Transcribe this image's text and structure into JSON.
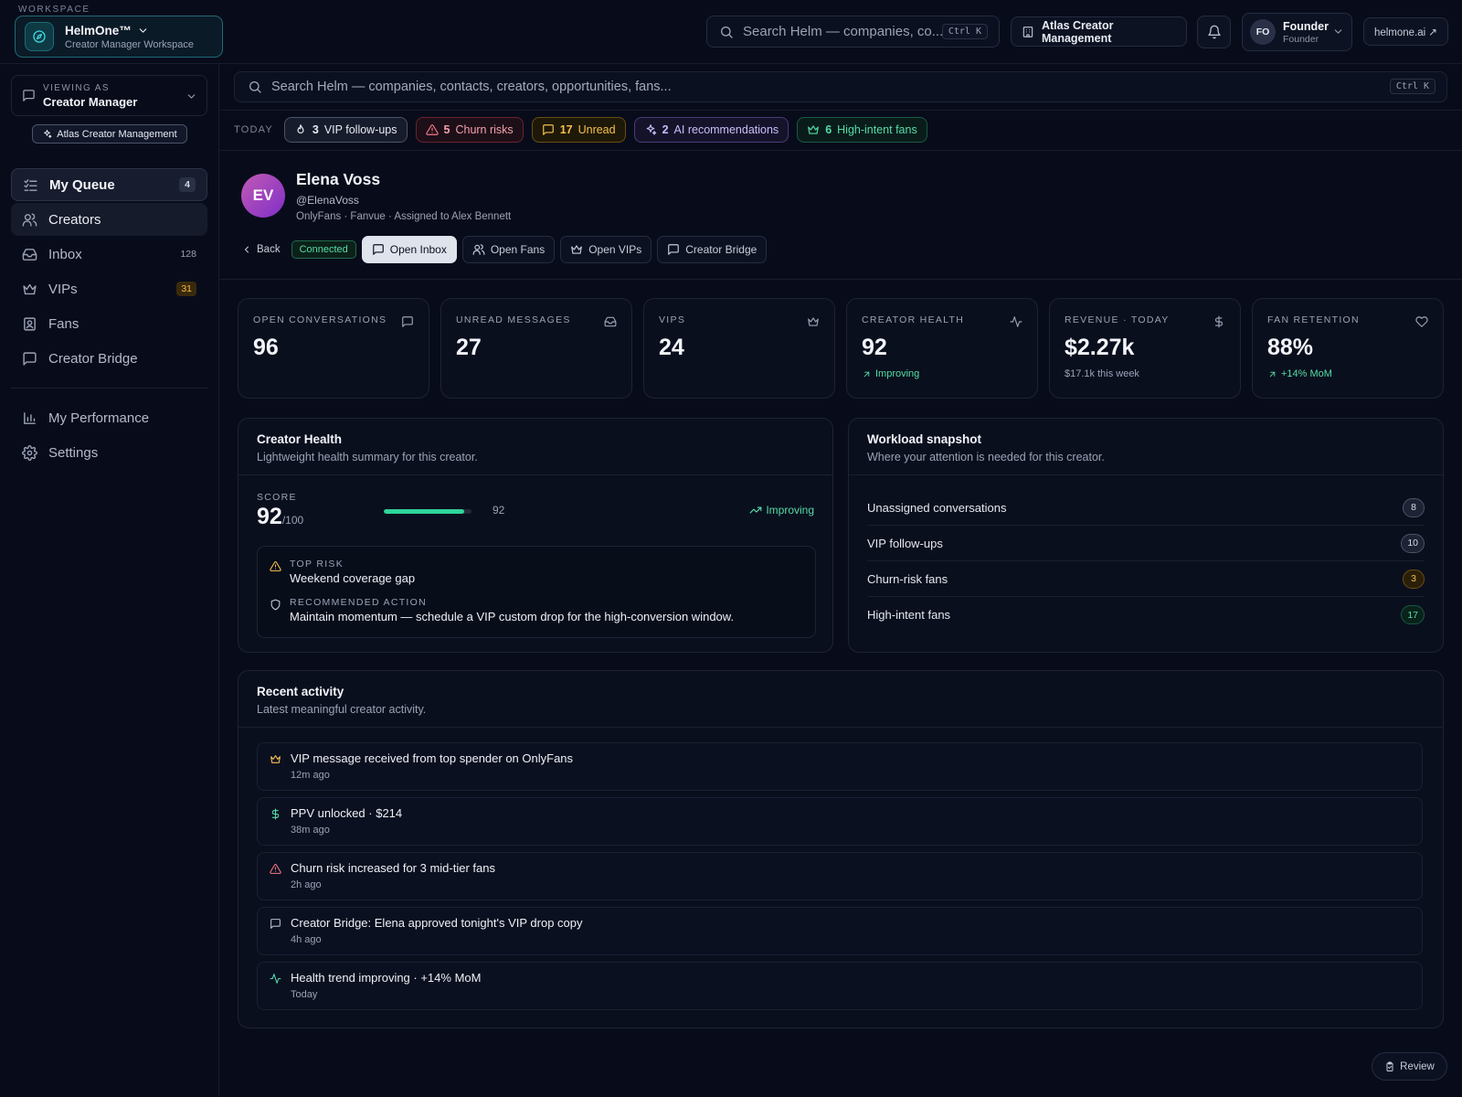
{
  "topbar": {
    "workspace_caption": "WORKSPACE",
    "workspace_name": "HelmOne™",
    "workspace_sub": "Creator Manager Workspace",
    "search_placeholder": "Search Helm — companies, co...",
    "search_shortcut": "Ctrl K",
    "org_name": "Atlas Creator Management",
    "user_initials": "FO",
    "user_name": "Founder",
    "user_role": "Founder",
    "site_link": "helmone.ai ↗"
  },
  "sidebar": {
    "viewing_as_caption": "VIEWING AS",
    "viewing_as_value": "Creator Manager",
    "org_pill": "Atlas Creator Management",
    "items": [
      {
        "label": "My Queue",
        "badge": "4",
        "icon": "list-check-icon"
      },
      {
        "label": "Creators",
        "badge": "",
        "icon": "users-icon"
      },
      {
        "label": "Inbox",
        "badge": "128",
        "icon": "inbox-icon"
      },
      {
        "label": "VIPs",
        "badge": "31",
        "icon": "crown-icon"
      },
      {
        "label": "Fans",
        "badge": "",
        "icon": "contact-icon"
      },
      {
        "label": "Creator Bridge",
        "badge": "",
        "icon": "message-icon"
      }
    ],
    "secondary": [
      {
        "label": "My Performance",
        "icon": "bar-chart-icon"
      },
      {
        "label": "Settings",
        "icon": "gear-icon"
      }
    ]
  },
  "main_search": {
    "placeholder": "Search Helm — companies, contacts, creators, opportunities, fans...",
    "shortcut": "Ctrl K"
  },
  "today": {
    "caption": "TODAY",
    "chips": [
      {
        "count": "3",
        "label": "VIP follow-ups",
        "tone": "neutral",
        "icon": "flame-icon"
      },
      {
        "count": "5",
        "label": "Churn risks",
        "tone": "red",
        "icon": "warning-icon"
      },
      {
        "count": "17",
        "label": "Unread",
        "tone": "amber",
        "icon": "message-icon"
      },
      {
        "count": "2",
        "label": "AI recommendations",
        "tone": "violet",
        "icon": "sparkles-icon"
      },
      {
        "count": "6",
        "label": "High-intent fans",
        "tone": "green",
        "icon": "crown-icon"
      }
    ]
  },
  "creator": {
    "initials": "EV",
    "name": "Elena Voss",
    "handle": "@ElenaVoss",
    "meta": "OnlyFans · Fanvue · Assigned to Alex Bennett",
    "back_label": "Back",
    "status": "Connected",
    "actions": [
      "Open Inbox",
      "Open Fans",
      "Open VIPs",
      "Creator Bridge"
    ]
  },
  "metrics": [
    {
      "caption": "OPEN CONVERSATIONS",
      "value": "96",
      "sub": "",
      "icon": "message-icon"
    },
    {
      "caption": "UNREAD MESSAGES",
      "value": "27",
      "sub": "",
      "icon": "inbox-icon"
    },
    {
      "caption": "VIPS",
      "value": "24",
      "sub": "",
      "icon": "crown-icon"
    },
    {
      "caption": "CREATOR HEALTH",
      "value": "92",
      "sub": "Improving",
      "icon": "activity-icon"
    },
    {
      "caption": "REVENUE · TODAY",
      "value": "$2.27k",
      "sub": "$17.1k this week",
      "icon": "dollar-icon"
    },
    {
      "caption": "FAN RETENTION",
      "value": "88%",
      "sub": "+14% MoM",
      "icon": "heart-icon"
    }
  ],
  "health": {
    "title": "Creator Health",
    "subtitle": "Lightweight health summary for this creator.",
    "score_caption": "SCORE",
    "score": "92",
    "score_max": "/100",
    "score_fraction": 0.92,
    "bar_label": "92",
    "trend": "Improving",
    "top_risk_caption": "TOP RISK",
    "top_risk": "Weekend coverage gap",
    "action_caption": "RECOMMENDED ACTION",
    "action": "Maintain momentum — schedule a VIP custom drop for the high-conversion window."
  },
  "workload": {
    "title": "Workload snapshot",
    "subtitle": "Where your attention is needed for this creator.",
    "rows": [
      {
        "label": "Unassigned conversations",
        "count": "8",
        "tone": "gray"
      },
      {
        "label": "VIP follow-ups",
        "count": "10",
        "tone": "gray"
      },
      {
        "label": "Churn-risk fans",
        "count": "3",
        "tone": "amber"
      },
      {
        "label": "High-intent fans",
        "count": "17",
        "tone": "green"
      }
    ]
  },
  "activity": {
    "title": "Recent activity",
    "subtitle": "Latest meaningful creator activity.",
    "items": [
      {
        "title": "VIP message received from top spender on OnlyFans",
        "time": "12m ago",
        "icon": "crown-icon",
        "color": "#f5c04e"
      },
      {
        "title": "PPV unlocked · $214",
        "time": "38m ago",
        "icon": "dollar-icon",
        "color": "#55dca7"
      },
      {
        "title": "Churn risk increased for 3 mid-tier fans",
        "time": "2h ago",
        "icon": "warning-icon",
        "color": "#f47785"
      },
      {
        "title": "Creator Bridge: Elena approved tonight's VIP drop copy",
        "time": "4h ago",
        "icon": "message-icon",
        "color": "#b7bed0"
      },
      {
        "title": "Health trend improving · +14% MoM",
        "time": "Today",
        "icon": "activity-icon",
        "color": "#55dca7"
      }
    ]
  },
  "review_label": "Review"
}
